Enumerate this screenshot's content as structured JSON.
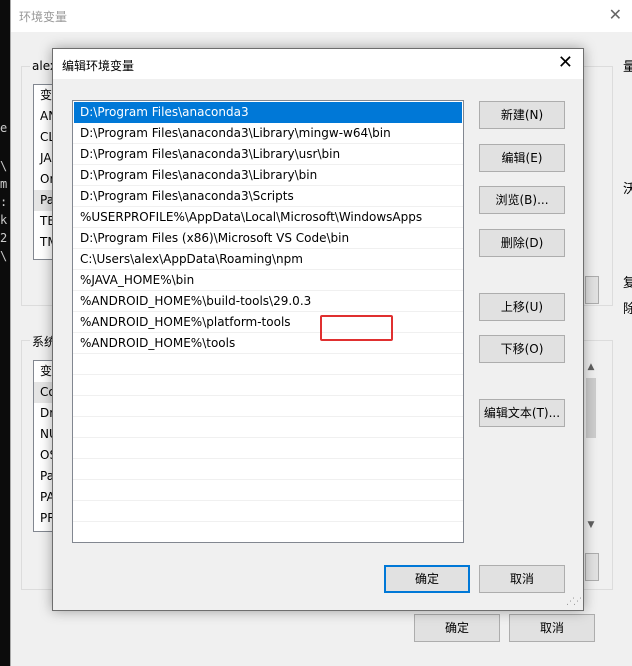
{
  "terminal_glyphs": [
    "e",
    "\\",
    "m",
    ":",
    "k",
    "2",
    "\\"
  ],
  "background_dialog": {
    "title": "环境变量",
    "user_group_label": "alex",
    "user_list_header": "变",
    "user_list_items": [
      "AN",
      "CL",
      "JA",
      "Or",
      "Pa",
      "TE",
      "TM"
    ],
    "system_group_label": "系统",
    "system_list_header": "变",
    "system_list_items": [
      "Co",
      "Dr",
      "NU",
      "OS",
      "Pa",
      "PA",
      "PR"
    ],
    "right_edge_glyphs": [
      "量",
      "沃",
      "复",
      "除"
    ],
    "ok_button": "确定",
    "cancel_button": "取消"
  },
  "dialog": {
    "title": "编辑环境变量",
    "paths": [
      "D:\\Program Files\\anaconda3",
      "D:\\Program Files\\anaconda3\\Library\\mingw-w64\\bin",
      "D:\\Program Files\\anaconda3\\Library\\usr\\bin",
      "D:\\Program Files\\anaconda3\\Library\\bin",
      "D:\\Program Files\\anaconda3\\Scripts",
      "%USERPROFILE%\\AppData\\Local\\Microsoft\\WindowsApps",
      "D:\\Program Files (x86)\\Microsoft VS Code\\bin",
      "C:\\Users\\alex\\AppData\\Roaming\\npm",
      "%JAVA_HOME%\\bin",
      "%ANDROID_HOME%\\build-tools\\29.0.3",
      "%ANDROID_HOME%\\platform-tools",
      "%ANDROID_HOME%\\tools"
    ],
    "selected_index": 0,
    "highlighted_index": 9,
    "buttons": {
      "new": "新建(N)",
      "edit": "编辑(E)",
      "browse": "浏览(B)...",
      "delete": "删除(D)",
      "move_up": "上移(U)",
      "move_down": "下移(O)",
      "edit_text": "编辑文本(T)...",
      "ok": "确定",
      "cancel": "取消"
    }
  },
  "colors": {
    "selection": "#0078d7",
    "highlight_box": "#e03030"
  }
}
